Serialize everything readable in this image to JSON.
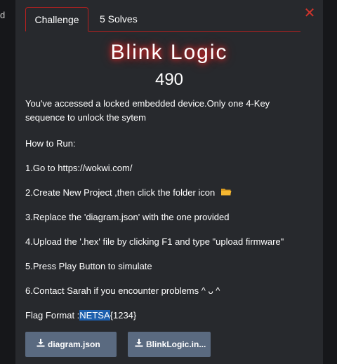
{
  "backdrop": {
    "left_glyph": "d"
  },
  "tabs": [
    {
      "label": "Challenge"
    },
    {
      "label": "5 Solves"
    }
  ],
  "close": {
    "glyph": "✕"
  },
  "challenge": {
    "title": "Blink Logic",
    "points": "490",
    "description_line1": "You've accessed a locked embedded device.Only one 4-Key",
    "description_line2": "sequence to unlock the sytem",
    "how_to_run": "How to Run:",
    "step1": "1.Go to https://wokwi.com/",
    "step2": "2.Create New Project ,then click the folder icon",
    "step3": "3.Replace the 'diagram.json' with the one provided",
    "step4": "4.Upload the '.hex' file by clicking F1 and type \"upload firmware\"",
    "step5": "5.Press Play Button to simulate",
    "step6": "6.Contact Sarah if you encounter problems ^ ᴗ ^",
    "flag_prefix": "Flag Format :",
    "flag_highlight": "NETSA",
    "flag_suffix": "{1234}"
  },
  "files": [
    {
      "label": "diagram.json"
    },
    {
      "label": "BlinkLogic.in..."
    }
  ],
  "colors": {
    "accent_red": "#b8201f",
    "button_bg": "#5a6a80",
    "highlight": "#1c5fae",
    "folder_yellow": "#f5b731"
  }
}
